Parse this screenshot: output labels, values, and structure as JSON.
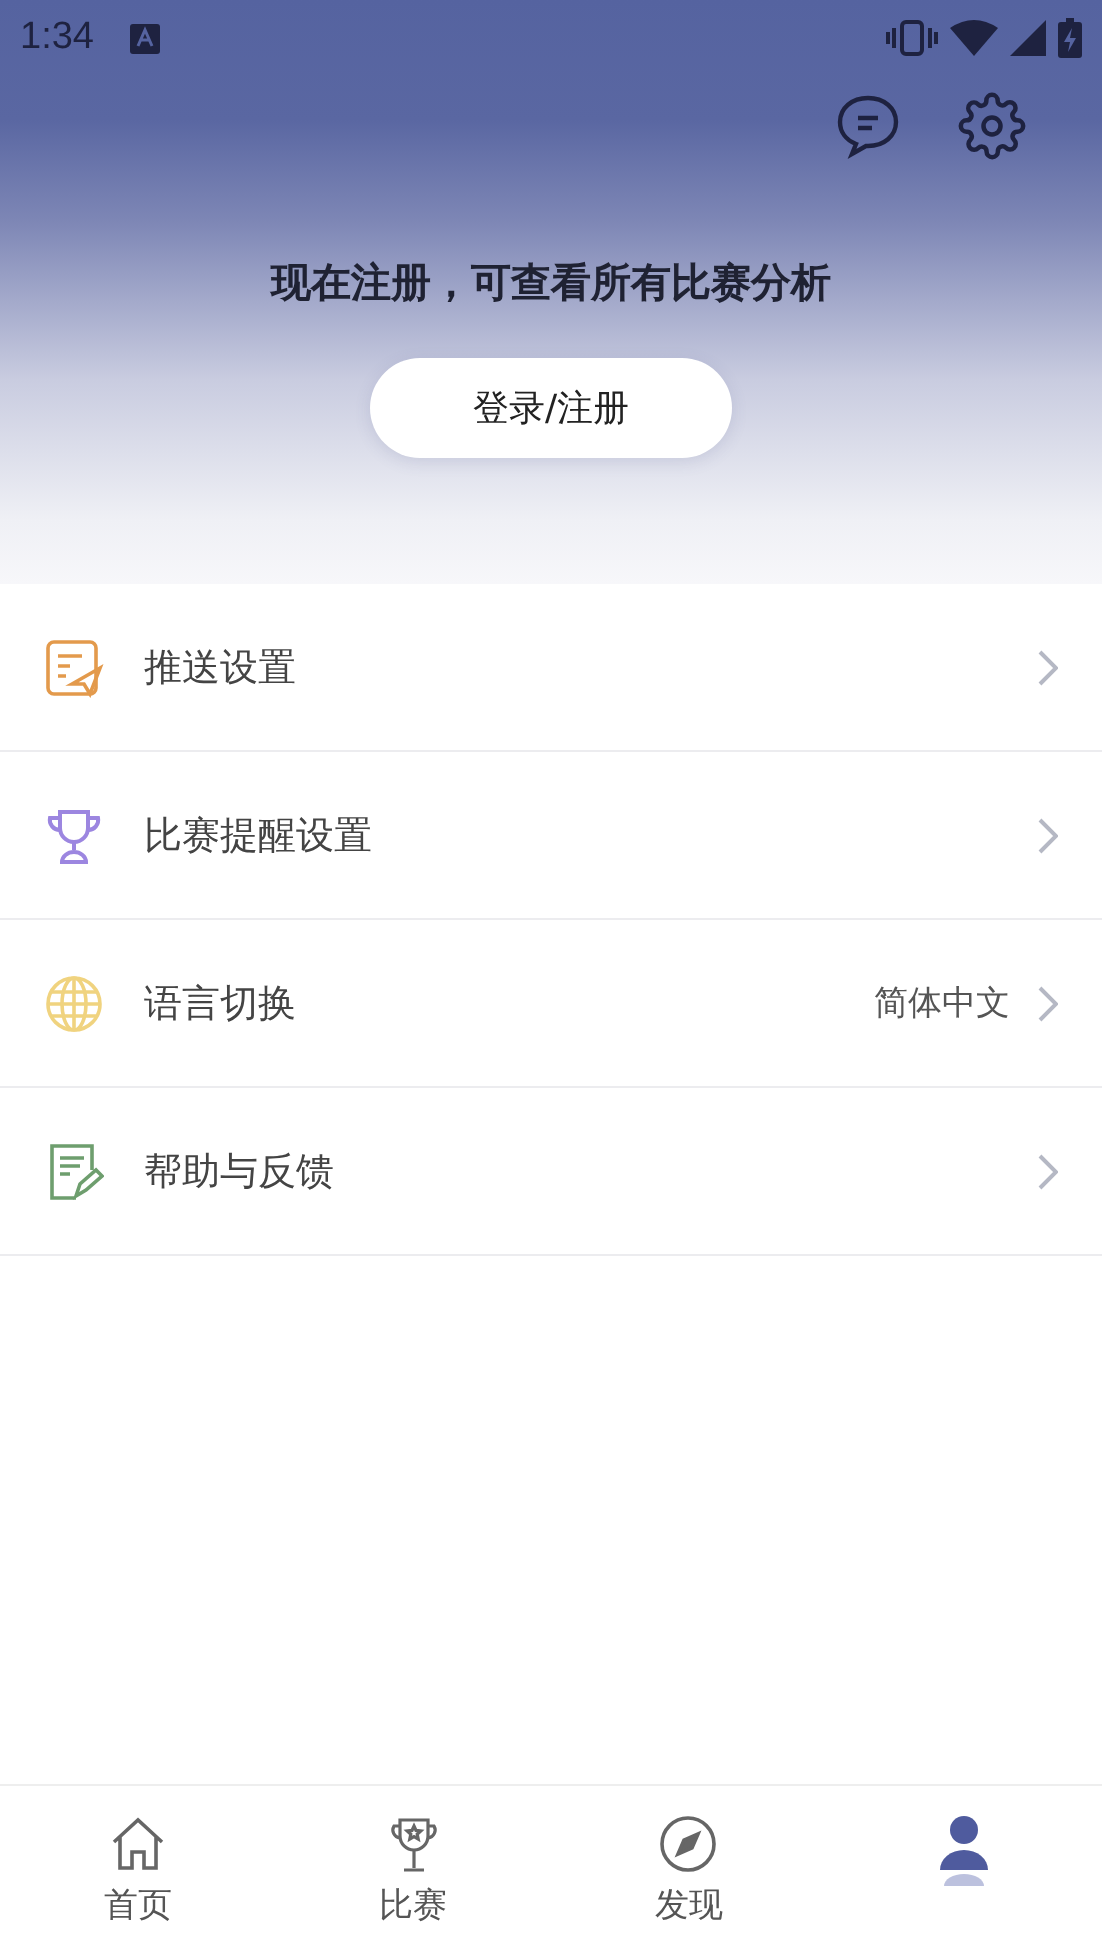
{
  "status_bar": {
    "time": "1:34"
  },
  "header": {
    "prompt": "现在注册，可查看所有比赛分析",
    "login_button": "登录/注册"
  },
  "menu": [
    {
      "kind": "push",
      "label": "推送设置"
    },
    {
      "kind": "trophy",
      "label": "比赛提醒设置"
    },
    {
      "kind": "globe",
      "label": "语言切换",
      "value": "简体中文"
    },
    {
      "kind": "feedback",
      "label": "帮助与反馈"
    }
  ],
  "tabs": [
    {
      "kind": "home",
      "label": "首页",
      "selected": false
    },
    {
      "kind": "trophy",
      "label": "比赛",
      "selected": false
    },
    {
      "kind": "compass",
      "label": "发现",
      "selected": false
    },
    {
      "kind": "profile",
      "selected": true
    }
  ]
}
